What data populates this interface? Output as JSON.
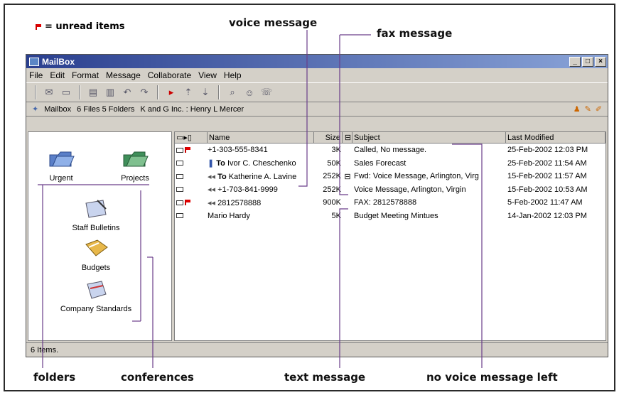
{
  "legend": {
    "text": "= unread items"
  },
  "callouts": {
    "voice_message": "voice message",
    "fax_message": "fax message",
    "folders": "folders",
    "conferences": "conferences",
    "text_message": "text message",
    "no_voice_message_left": "no voice message left"
  },
  "window": {
    "title": "MailBox",
    "buttons": [
      "_",
      "□",
      "×"
    ]
  },
  "menu": [
    "File",
    "Edit",
    "Format",
    "Message",
    "Collaborate",
    "View",
    "Help"
  ],
  "address": {
    "mailbox": "Mailbox",
    "counts": "6 Files 5 Folders",
    "owner": "K and G Inc. : Henry L Mercer"
  },
  "folders": [
    {
      "label": "Urgent"
    },
    {
      "label": "Projects"
    }
  ],
  "conferences": [
    {
      "label": "Staff Bulletins"
    },
    {
      "label": "Budgets"
    },
    {
      "label": "Company Standards"
    }
  ],
  "columns": {
    "name": "Name",
    "size": "Size",
    "subject": "Subject",
    "modified": "Last Modified"
  },
  "messages": [
    {
      "unread": true,
      "attach": false,
      "voice": false,
      "to": "",
      "name": "+1-303-555-8341",
      "size": "3K",
      "exp": "",
      "subject": "Called, No message.",
      "modified": "25-Feb-2002 12:03 PM"
    },
    {
      "unread": false,
      "attach": true,
      "voice": false,
      "to": "To",
      "name": "Ivor C. Cheschenko",
      "size": "50K",
      "exp": "",
      "subject": "Sales Forecast",
      "modified": "25-Feb-2002 11:54 AM"
    },
    {
      "unread": false,
      "attach": false,
      "voice": true,
      "to": "To",
      "name": "Katherine A. Lavine",
      "size": "252K",
      "exp": "⊟",
      "subject": "Fwd: Voice Message, Arlington, Virg",
      "modified": "15-Feb-2002 11:57 AM"
    },
    {
      "unread": false,
      "attach": false,
      "voice": true,
      "to": "",
      "name": "+1-703-841-9999",
      "size": "252K",
      "exp": "",
      "subject": "Voice Message, Arlington, Virgin",
      "modified": "15-Feb-2002 10:53 AM"
    },
    {
      "unread": true,
      "attach": false,
      "voice": true,
      "to": "",
      "name": "2812578888",
      "size": "900K",
      "exp": "",
      "subject": "FAX: 2812578888",
      "modified": "5-Feb-2002 11:47 AM"
    },
    {
      "unread": false,
      "attach": false,
      "voice": false,
      "to": "",
      "name": "Mario Hardy",
      "size": "5K",
      "exp": "",
      "subject": "Budget Meeting Mintues",
      "modified": "14-Jan-2002 12:03 PM"
    }
  ],
  "status": "6 Items.",
  "colors": {
    "title_start": "#2a3f8f",
    "title_end": "#8aa4d8",
    "unread_flag": "#e00000",
    "callout_line": "#6a3d8a"
  }
}
